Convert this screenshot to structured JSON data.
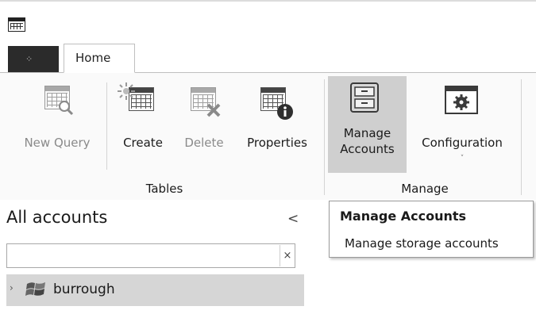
{
  "tabs": {
    "file_label": "",
    "home_label": "Home"
  },
  "ribbon": {
    "tables_group": {
      "label": "Tables",
      "buttons": {
        "new_query": "New Query",
        "create": "Create",
        "delete": "Delete",
        "properties": "Properties"
      }
    },
    "manage_group": {
      "label": "Manage",
      "buttons": {
        "manage_accounts_line1": "Manage",
        "manage_accounts_line2": "Accounts",
        "configuration": "Configuration",
        "configuration_dropdown": "˅"
      }
    }
  },
  "sidebar": {
    "title": "All accounts",
    "collapse_glyph": "<",
    "search": {
      "value": "",
      "clear_glyph": "×"
    },
    "tree": [
      {
        "label": "burrough",
        "expander": "›"
      }
    ]
  },
  "tooltip": {
    "title": "Manage Accounts",
    "description": "Manage storage accounts"
  },
  "icons": {
    "app": "table-window-icon",
    "new_query": "table-search-icon",
    "create": "table-new-icon",
    "delete": "table-delete-icon",
    "properties": "table-info-icon",
    "manage_accounts": "file-cabinet-icon",
    "configuration": "gear-window-icon",
    "account": "windows-flag-icon"
  },
  "colors": {
    "file_tab": "#2b2b2b",
    "selected_button": "#cfcfcf",
    "tree_selection": "#d6d6d6"
  }
}
